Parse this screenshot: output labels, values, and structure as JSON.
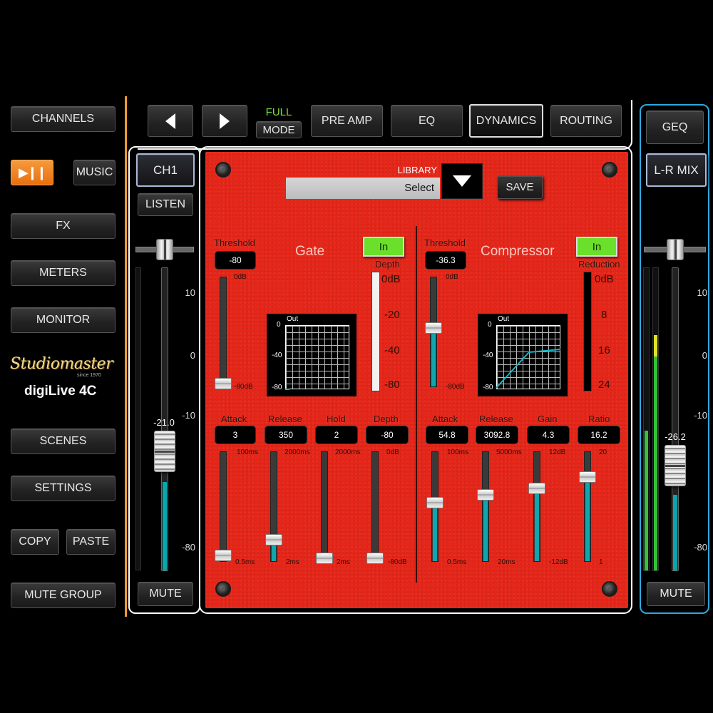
{
  "sidebar": {
    "channels": "CHANNELS",
    "music": "MUSIC",
    "fx": "FX",
    "meters": "METERS",
    "monitor": "MONITOR",
    "brand": "Studiomaster",
    "brand_since": "since 1970",
    "product": "digiLive 4C",
    "scenes": "SCENES",
    "settings": "SETTINGS",
    "copy": "COPY",
    "paste": "PASTE",
    "mute_group": "MUTE GROUP"
  },
  "topbar": {
    "full": "FULL",
    "mode": "MODE",
    "tabs": [
      "PRE AMP",
      "EQ",
      "DYNAMICS",
      "ROUTING"
    ],
    "selected_tab": "DYNAMICS"
  },
  "channel": {
    "name": "CH1",
    "listen": "LISTEN",
    "level": "-21.0",
    "scale": [
      "10",
      "0",
      "-10",
      "-80"
    ],
    "mute": "MUTE"
  },
  "master": {
    "geq": "GEQ",
    "name": "L-R MIX",
    "level": "-26.2",
    "scale": [
      "10",
      "0",
      "-10",
      "-80"
    ],
    "mute": "MUTE"
  },
  "library": {
    "label": "LIBRARY",
    "select": "Select",
    "save": "SAVE"
  },
  "gate": {
    "title": "Gate",
    "in": "In",
    "threshold_label": "Threshold",
    "threshold_value": "-80",
    "threshold_max": "0dB",
    "threshold_min": "-80dB",
    "depth_meter_label": "Depth",
    "depth_scale": [
      "0dB",
      "-20",
      "-40",
      "-80"
    ],
    "graph_out": "Out",
    "graph_ticks": [
      "0",
      "-40",
      "-80"
    ],
    "params": [
      {
        "label": "Attack",
        "value": "3",
        "max": "100ms",
        "min": "0.5ms"
      },
      {
        "label": "Release",
        "value": "350",
        "max": "2000ms",
        "min": "2ms"
      },
      {
        "label": "Hold",
        "value": "2",
        "max": "2000ms",
        "min": "2ms"
      },
      {
        "label": "Depth",
        "value": "-80",
        "max": "0dB",
        "min": "-80dB"
      }
    ]
  },
  "compressor": {
    "title": "Compressor",
    "in": "In",
    "threshold_label": "Threshold",
    "threshold_value": "-36.3",
    "threshold_max": "0dB",
    "threshold_min": "-80dB",
    "reduction_label": "Reduction",
    "reduction_scale": [
      "0dB",
      "8",
      "16",
      "24"
    ],
    "graph_out": "Out",
    "graph_ticks": [
      "0",
      "-40",
      "-80"
    ],
    "params": [
      {
        "label": "Attack",
        "value": "54.8",
        "max": "100ms",
        "min": "0.5ms"
      },
      {
        "label": "Release",
        "value": "3092.8",
        "max": "5000ms",
        "min": "20ms"
      },
      {
        "label": "Gain",
        "value": "4.3",
        "max": "12dB",
        "min": "-12dB"
      },
      {
        "label": "Ratio",
        "value": "16.2",
        "max": "20",
        "min": "1"
      }
    ]
  },
  "colors": {
    "panel_red": "#e52619",
    "active_orange": "#f07a1c",
    "in_green": "#6be02b",
    "fader_teal": "#0aa6ab",
    "channel_frame": "#ffffff",
    "master_frame": "#2fa8e0",
    "divider_orange": "#f29b30"
  }
}
